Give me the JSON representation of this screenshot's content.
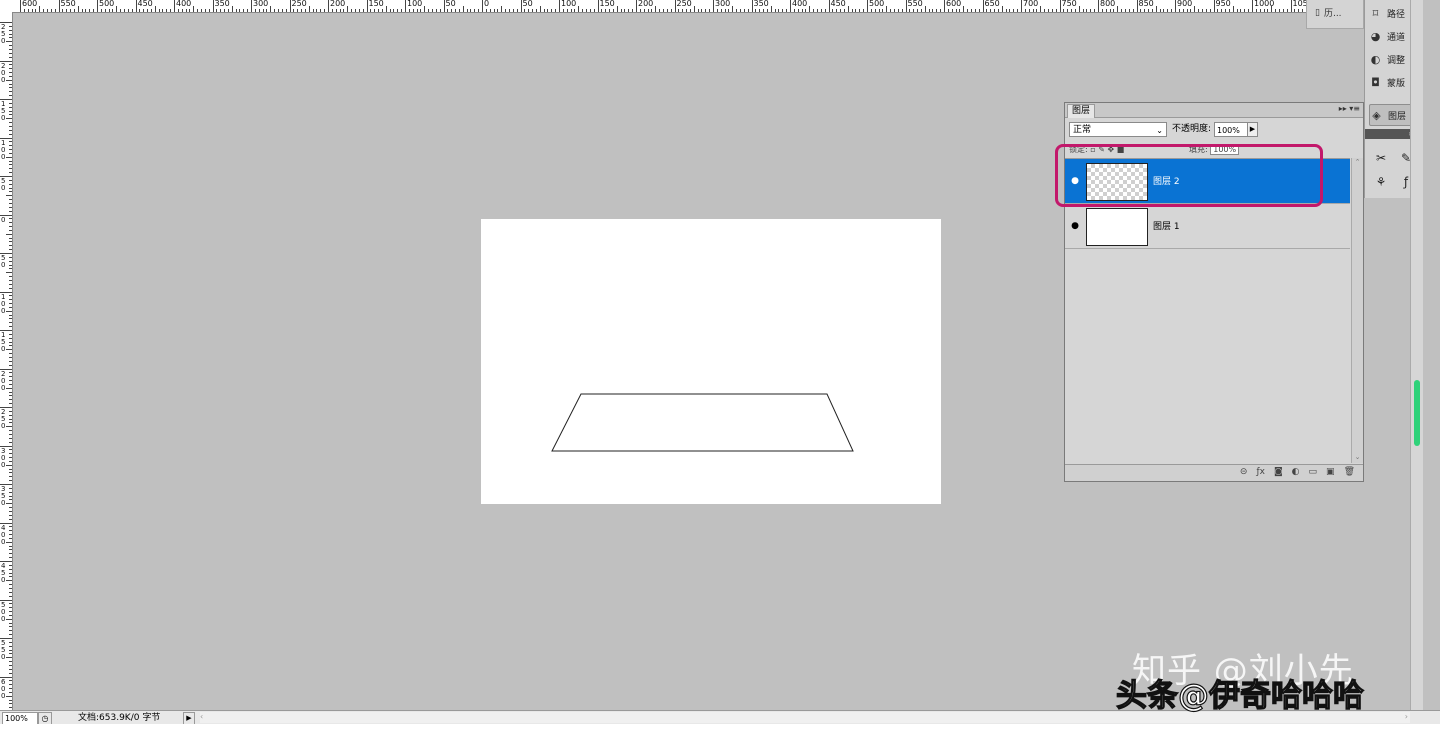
{
  "ruler_top_labels": [
    "600",
    "550",
    "500",
    "450",
    "400",
    "350",
    "300",
    "250",
    "200",
    "150",
    "100",
    "50",
    "0",
    "50",
    "100",
    "150",
    "200",
    "250",
    "300",
    "350",
    "400",
    "450",
    "500",
    "550",
    "600",
    "650",
    "700",
    "750",
    "800",
    "850",
    "900",
    "950",
    "1000",
    "1050"
  ],
  "ruler_left_labels": [
    "250",
    "200",
    "150",
    "100",
    "50",
    "0",
    "50",
    "100",
    "150",
    "200",
    "250",
    "300",
    "350",
    "400",
    "450",
    "500",
    "550",
    "600"
  ],
  "dock": {
    "mini_label": "历...",
    "items": [
      {
        "icon": "paths-icon",
        "label": "路径"
      },
      {
        "icon": "channels-icon",
        "label": "通道"
      },
      {
        "icon": "adjustments-icon",
        "label": "调整"
      },
      {
        "icon": "masks-icon",
        "label": "蒙版"
      },
      {
        "icon": "layers-icon",
        "label": "图层"
      }
    ]
  },
  "layers_panel": {
    "tab_title": "图层",
    "blend_mode": "正常",
    "opacity_label": "不透明度:",
    "opacity_value": "100%",
    "lock_label": "锁定:",
    "fill_label": "填充:",
    "fill_value": "100%",
    "layers": [
      {
        "name": "图层 2",
        "selected": true,
        "thumb": "transparent"
      },
      {
        "name": "图层 1",
        "selected": false,
        "thumb": "white"
      }
    ]
  },
  "status_bar": {
    "zoom": "100%",
    "doc_info": "文档:653.9K/0 字节"
  },
  "watermark": {
    "line1": "知乎 @刘小先",
    "line2": "头条@伊奇哈哈哈"
  },
  "colors": {
    "workspace": "#c0c0c0",
    "selection_blue": "#0a73d3",
    "highlight_magenta": "#c2186b"
  }
}
